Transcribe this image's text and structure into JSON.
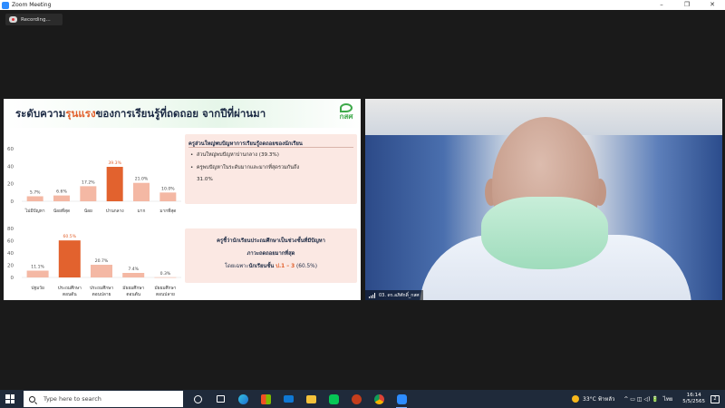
{
  "window": {
    "title": "Zoom Meeting",
    "controls": [
      "–",
      "❐",
      "✕"
    ]
  },
  "recording": {
    "label": "Recording..."
  },
  "slide": {
    "title_pre": "ระดับความ",
    "title_highlight": "รุนแรง",
    "title_post": "ของการเรียนรู้ที่ถดถอย จากปีที่ผ่านมา",
    "logo_text": "กสศ",
    "box1": {
      "heading": "ครูส่วนใหญ่พบปัญหาการเรียนรู้ถดถอยของนักเรียน",
      "bullet1": "ส่วนใหญ่พบปัญหาปานกลาง (39.3%)",
      "bullet2": "ครูพบปัญหาในระดับมากและมากที่สุดรวมกันถึง",
      "bullet2_cont": "31.0%"
    },
    "box2": {
      "line1": "ครูชี้ว่านักเรียนประถมศึกษาเป็นช่วงชั้นที่มีปัญหา",
      "line2": "ภาวะถดถอยมากที่สุด",
      "line3_pre": "โดยเฉพาะ",
      "line3_bold": "นักเรียนชั้น ",
      "line3_highlight": "ป.1 – 3",
      "line3_post": " (60.5%)"
    }
  },
  "chart_data": [
    {
      "type": "bar",
      "categories": [
        "ไม่มีปัญหา",
        "น้อยที่สุด",
        "น้อย",
        "ปานกลาง",
        "มาก",
        "มากที่สุด"
      ],
      "values": [
        5.7,
        6.6,
        17.2,
        39.3,
        21.0,
        10.0
      ],
      "data_labels": [
        "5.7%",
        "6.6%",
        "17.2%",
        "39.3%",
        "21.0%",
        "10.0%"
      ],
      "highlight_index": 3,
      "ylim": [
        0,
        60
      ],
      "yticks": [
        0,
        20,
        40,
        60
      ],
      "colors": {
        "bar": "#f4b8a4",
        "highlight": "#e2622e"
      }
    },
    {
      "type": "bar",
      "categories": [
        [
          "ปฐมวัย"
        ],
        [
          "ประถมศึกษา",
          "ตอนต้น"
        ],
        [
          "ประถมศึกษา",
          "ตอนปลาย"
        ],
        [
          "มัธยมศึกษา",
          "ตอนต้น"
        ],
        [
          "มัธยมศึกษา",
          "ตอนปลาย"
        ]
      ],
      "values": [
        11.1,
        60.5,
        20.7,
        7.4,
        0.3
      ],
      "data_labels": [
        "11.1%",
        "60.5%",
        "20.7%",
        "7.4%",
        "0.3%"
      ],
      "highlight_index": 1,
      "ylim": [
        0,
        80
      ],
      "yticks": [
        0,
        20,
        40,
        60,
        80
      ],
      "colors": {
        "bar": "#f4b8a4",
        "highlight": "#e2622e"
      }
    }
  ],
  "video": {
    "participant_name": "03. ดร.อภิศักดิ์_กสศ"
  },
  "taskbar": {
    "search_placeholder": "Type here to search",
    "apps": [
      "task-view",
      "edge",
      "store",
      "mail",
      "files",
      "line",
      "powerpoint",
      "chrome",
      "zoom"
    ],
    "weather": "33°C ฟ้าหลัว",
    "tray_icons": "^ ▭ ◫ ◁) 🔋",
    "language": "ไทย",
    "time": "16:14",
    "date": "5/5/2565",
    "notifications": "2"
  }
}
